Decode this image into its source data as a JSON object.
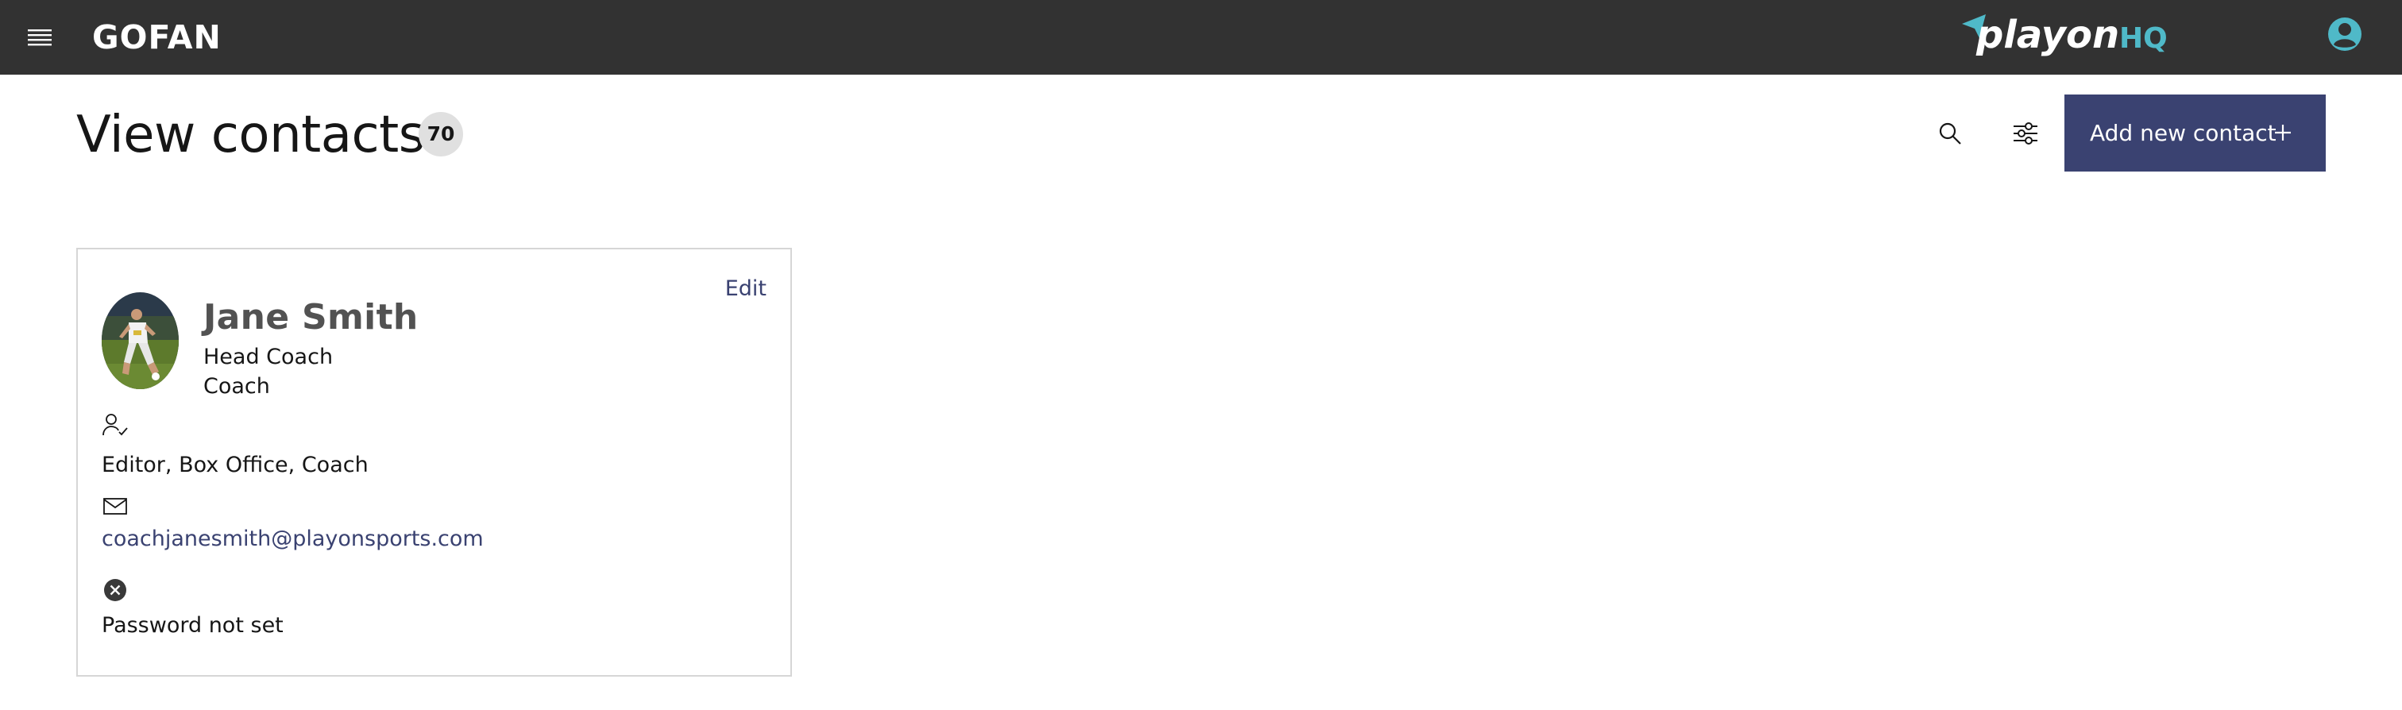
{
  "header": {
    "brand": "GOFAN",
    "logo_text_main": "playon",
    "logo_text_suffix": "HQ",
    "menu_icon": "hamburger-menu-icon",
    "account_icon": "user-avatar-icon",
    "colors": {
      "bar": "#323232",
      "logo_accent": "#4fb9c8"
    }
  },
  "page": {
    "title": "View contacts",
    "count": "70",
    "search_icon": "search-icon",
    "filter_icon": "filter-sliders-icon",
    "add_button_label": "Add new contact",
    "add_button_icon": "plus-icon",
    "colors": {
      "primary": "#3a4271"
    }
  },
  "contacts": [
    {
      "name": "Jane Smith",
      "title": "Head Coach",
      "role": "Coach",
      "edit_label": "Edit",
      "permissions": "Editor, Box Office, Coach",
      "permissions_icon": "user-check-icon",
      "email": "coachjanesmith@playonsports.com",
      "email_icon": "envelope-icon",
      "password_status": "Password not set",
      "password_icon": "close-circle-icon"
    }
  ]
}
